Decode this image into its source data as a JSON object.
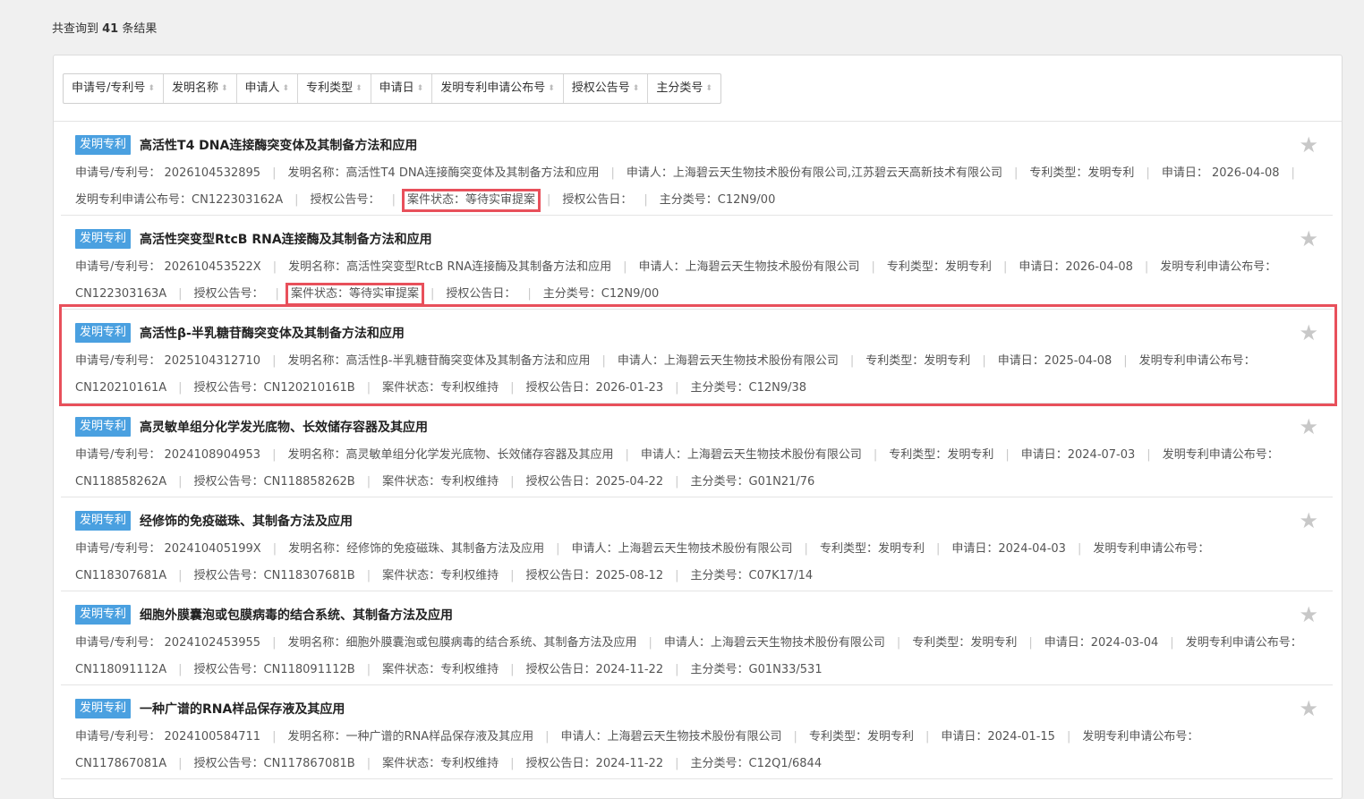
{
  "summary": {
    "prefix": "共查询到 ",
    "count": "41",
    "suffix": " 条结果"
  },
  "sort_buttons": [
    {
      "label": "申请号/专利号"
    },
    {
      "label": "发明名称"
    },
    {
      "label": "申请人"
    },
    {
      "label": "专利类型"
    },
    {
      "label": "申请日"
    },
    {
      "label": "发明专利申请公布号"
    },
    {
      "label": "授权公告号"
    },
    {
      "label": "主分类号"
    }
  ],
  "sort_arrow": "⬍",
  "colors": {
    "accent": "#4aa0e0",
    "highlight": "#e8505b",
    "star": "#c8c8c8"
  },
  "fields": {
    "app_no": "申请号/专利号：",
    "name": "发明名称：",
    "applicant": "申请人：",
    "ptype": "专利类型：",
    "app_date": "申请日：",
    "pub_no": "发明专利申请公布号：",
    "grant_no": "授权公告号：",
    "status": "案件状态：",
    "grant_date": "授权公告日：",
    "class": "主分类号："
  },
  "star_icon": "★",
  "results": [
    {
      "type": "发明专利",
      "title": "高活性T4 DNA连接酶突变体及其制备方法和应用",
      "app_no": "2026104532895",
      "name": "高活性T4 DNA连接酶突变体及其制备方法和应用",
      "applicant": "上海碧云天生物技术股份有限公司,江苏碧云天高新技术有限公司",
      "ptype": "发明专利",
      "app_date": "2026-04-08",
      "pub_no": "CN122303162A",
      "grant_no": "",
      "status": "等待实审提案",
      "grant_date": "",
      "class": "C12N9/00"
    },
    {
      "type": "发明专利",
      "title": "高活性突变型RtcB RNA连接酶及其制备方法和应用",
      "app_no": "202610453522X",
      "name": "高活性突变型RtcB RNA连接酶及其制备方法和应用",
      "applicant": "上海碧云天生物技术股份有限公司",
      "ptype": "发明专利",
      "app_date": "2026-04-08",
      "pub_no": "CN122303163A",
      "grant_no": "",
      "status": "等待实审提案",
      "grant_date": "",
      "class": "C12N9/00"
    },
    {
      "type": "发明专利",
      "title": "高活性β-半乳糖苷酶突变体及其制备方法和应用",
      "app_no": "2025104312710",
      "name": "高活性β-半乳糖苷酶突变体及其制备方法和应用",
      "applicant": "上海碧云天生物技术股份有限公司",
      "ptype": "发明专利",
      "app_date": "2025-04-08",
      "pub_no": "CN120210161A",
      "grant_no": "CN120210161B",
      "status": "专利权维持",
      "grant_date": "2026-01-23",
      "class": "C12N9/38"
    },
    {
      "type": "发明专利",
      "title": "高灵敏单组分化学发光底物、长效储存容器及其应用",
      "app_no": "2024108904953",
      "name": "高灵敏单组分化学发光底物、长效储存容器及其应用",
      "applicant": "上海碧云天生物技术股份有限公司",
      "ptype": "发明专利",
      "app_date": "2024-07-03",
      "pub_no": "CN118858262A",
      "grant_no": "CN118858262B",
      "status": "专利权维持",
      "grant_date": "2025-04-22",
      "class": "G01N21/76"
    },
    {
      "type": "发明专利",
      "title": "经修饰的免疫磁珠、其制备方法及应用",
      "app_no": "202410405199X",
      "name": "经修饰的免疫磁珠、其制备方法及应用",
      "applicant": "上海碧云天生物技术股份有限公司",
      "ptype": "发明专利",
      "app_date": "2024-04-03",
      "pub_no": "CN118307681A",
      "grant_no": "CN118307681B",
      "status": "专利权维持",
      "grant_date": "2025-08-12",
      "class": "C07K17/14"
    },
    {
      "type": "发明专利",
      "title": "细胞外膜囊泡或包膜病毒的结合系统、其制备方法及应用",
      "app_no": "2024102453955",
      "name": "细胞外膜囊泡或包膜病毒的结合系统、其制备方法及应用",
      "applicant": "上海碧云天生物技术股份有限公司",
      "ptype": "发明专利",
      "app_date": "2024-03-04",
      "pub_no": "CN118091112A",
      "grant_no": "CN118091112B",
      "status": "专利权维持",
      "grant_date": "2024-11-22",
      "class": "G01N33/531"
    },
    {
      "type": "发明专利",
      "title": "一种广谱的RNA样品保存液及其应用",
      "app_no": "2024100584711",
      "name": "一种广谱的RNA样品保存液及其应用",
      "applicant": "上海碧云天生物技术股份有限公司",
      "ptype": "发明专利",
      "app_date": "2024-01-15",
      "pub_no": "CN117867081A",
      "grant_no": "CN117867081B",
      "status": "专利权维持",
      "grant_date": "2024-11-22",
      "class": "C12Q1/6844"
    }
  ]
}
